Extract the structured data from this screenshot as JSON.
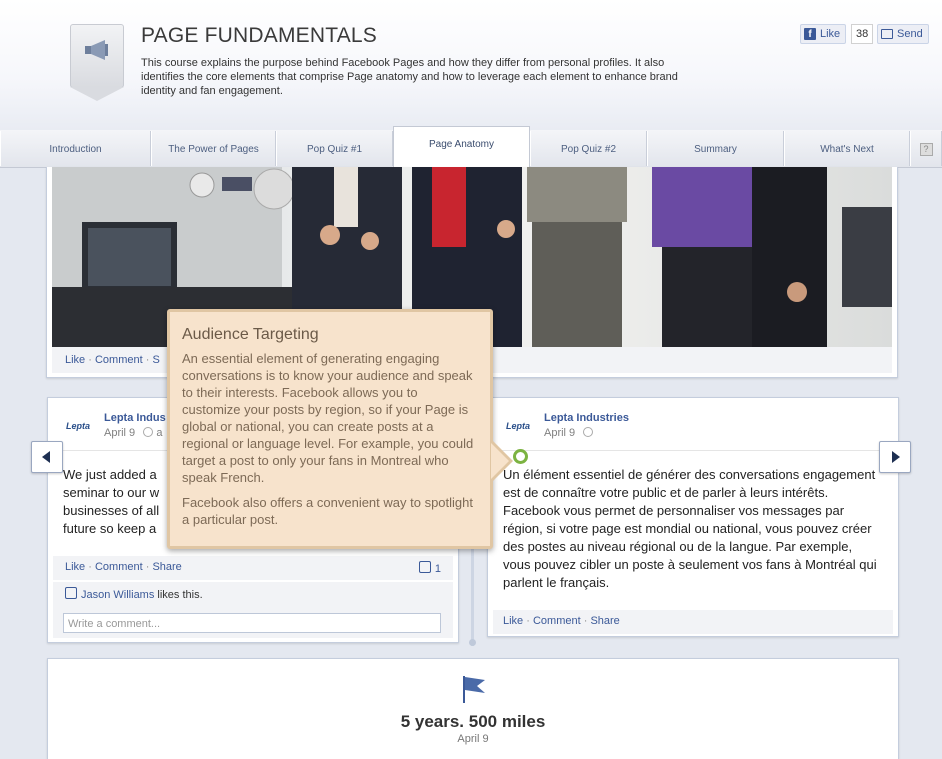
{
  "header": {
    "title": "PAGE FUNDAMENTALS",
    "description": "This course explains the purpose behind Facebook Pages and how they differ from personal profiles. It also identifies the core elements that comprise Page anatomy and how to leverage each element to enhance brand identity and fan engagement.",
    "like_label": "Like",
    "like_count": "38",
    "send_label": "Send",
    "course_icon": "megaphone-icon"
  },
  "tabs": [
    {
      "label": "Introduction"
    },
    {
      "label": "The Power of Pages"
    },
    {
      "label": "Pop Quiz #1"
    },
    {
      "label": "Page Anatomy",
      "active": true
    },
    {
      "label": "Pop Quiz #2"
    },
    {
      "label": "Summary"
    },
    {
      "label": "What's Next"
    },
    {
      "label": "?"
    }
  ],
  "photo_post": {
    "actions": {
      "like": "Like",
      "comment": "Comment",
      "share": "S"
    }
  },
  "left_post": {
    "author": "Lepta Indus",
    "date": "April 9",
    "date_suffix": "a",
    "logo": "Lepta",
    "text": "We just added a seminar to our w businesses of all future so keep a",
    "lines": [
      "We just added a",
      "seminar to our w",
      "businesses of all",
      "future so keep a"
    ],
    "actions": {
      "like": "Like",
      "comment": "Comment",
      "share": "Share"
    },
    "like_count": "1",
    "liker_name": "Jason Williams",
    "liker_suffix": "likes this.",
    "comment_placeholder": "Write a comment..."
  },
  "right_post": {
    "author": "Lepta Industries",
    "date": "April 9",
    "logo": "Lepta",
    "text": "Un élément essentiel de générer des conversations engagement est de connaître votre public et de parler à leurs intérêts. Facebook vous permet de personnaliser vos messages par région, si votre page est mondial ou national, vous pouvez créer des postes au niveau régional ou de la langue. Par exemple, vous pouvez cibler un poste à seulement vos fans à Montréal qui parlent le français.",
    "actions": {
      "like": "Like",
      "comment": "Comment",
      "share": "Share"
    }
  },
  "milestone": {
    "icon": "flag-icon",
    "title": "5 years. 500 miles",
    "date": "April 9"
  },
  "tooltip": {
    "title": "Audience Targeting",
    "paragraph1": "An essential element of generating engaging conversations is to know your audience and speak to their interests. Facebook allows you to customize your posts by region, so if your Page is global or national, you can create posts at a regional or language level. For example, you could target a post to only your fans in Montreal who speak French.",
    "paragraph2": "Facebook also offers a convenient way to spotlight a particular post."
  },
  "colors": {
    "facebook_blue": "#3b5998",
    "tooltip_bg": "#f7e3cc",
    "tooltip_border": "#e0c6a3",
    "hotspot": "#7cb342"
  }
}
